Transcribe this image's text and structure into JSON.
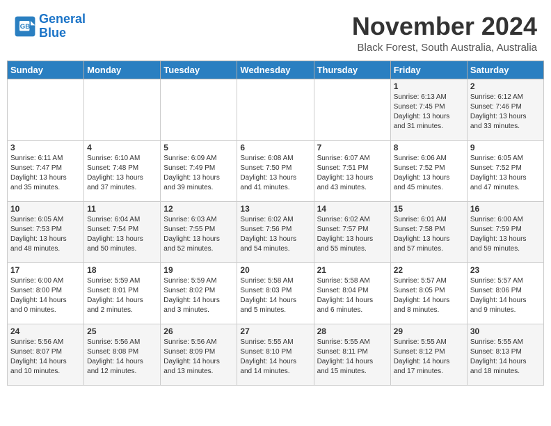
{
  "header": {
    "logo_line1": "General",
    "logo_line2": "Blue",
    "month_title": "November 2024",
    "location": "Black Forest, South Australia, Australia"
  },
  "weekdays": [
    "Sunday",
    "Monday",
    "Tuesday",
    "Wednesday",
    "Thursday",
    "Friday",
    "Saturday"
  ],
  "weeks": [
    [
      {
        "day": "",
        "info": ""
      },
      {
        "day": "",
        "info": ""
      },
      {
        "day": "",
        "info": ""
      },
      {
        "day": "",
        "info": ""
      },
      {
        "day": "",
        "info": ""
      },
      {
        "day": "1",
        "info": "Sunrise: 6:13 AM\nSunset: 7:45 PM\nDaylight: 13 hours\nand 31 minutes."
      },
      {
        "day": "2",
        "info": "Sunrise: 6:12 AM\nSunset: 7:46 PM\nDaylight: 13 hours\nand 33 minutes."
      }
    ],
    [
      {
        "day": "3",
        "info": "Sunrise: 6:11 AM\nSunset: 7:47 PM\nDaylight: 13 hours\nand 35 minutes."
      },
      {
        "day": "4",
        "info": "Sunrise: 6:10 AM\nSunset: 7:48 PM\nDaylight: 13 hours\nand 37 minutes."
      },
      {
        "day": "5",
        "info": "Sunrise: 6:09 AM\nSunset: 7:49 PM\nDaylight: 13 hours\nand 39 minutes."
      },
      {
        "day": "6",
        "info": "Sunrise: 6:08 AM\nSunset: 7:50 PM\nDaylight: 13 hours\nand 41 minutes."
      },
      {
        "day": "7",
        "info": "Sunrise: 6:07 AM\nSunset: 7:51 PM\nDaylight: 13 hours\nand 43 minutes."
      },
      {
        "day": "8",
        "info": "Sunrise: 6:06 AM\nSunset: 7:52 PM\nDaylight: 13 hours\nand 45 minutes."
      },
      {
        "day": "9",
        "info": "Sunrise: 6:05 AM\nSunset: 7:52 PM\nDaylight: 13 hours\nand 47 minutes."
      }
    ],
    [
      {
        "day": "10",
        "info": "Sunrise: 6:05 AM\nSunset: 7:53 PM\nDaylight: 13 hours\nand 48 minutes."
      },
      {
        "day": "11",
        "info": "Sunrise: 6:04 AM\nSunset: 7:54 PM\nDaylight: 13 hours\nand 50 minutes."
      },
      {
        "day": "12",
        "info": "Sunrise: 6:03 AM\nSunset: 7:55 PM\nDaylight: 13 hours\nand 52 minutes."
      },
      {
        "day": "13",
        "info": "Sunrise: 6:02 AM\nSunset: 7:56 PM\nDaylight: 13 hours\nand 54 minutes."
      },
      {
        "day": "14",
        "info": "Sunrise: 6:02 AM\nSunset: 7:57 PM\nDaylight: 13 hours\nand 55 minutes."
      },
      {
        "day": "15",
        "info": "Sunrise: 6:01 AM\nSunset: 7:58 PM\nDaylight: 13 hours\nand 57 minutes."
      },
      {
        "day": "16",
        "info": "Sunrise: 6:00 AM\nSunset: 7:59 PM\nDaylight: 13 hours\nand 59 minutes."
      }
    ],
    [
      {
        "day": "17",
        "info": "Sunrise: 6:00 AM\nSunset: 8:00 PM\nDaylight: 14 hours\nand 0 minutes."
      },
      {
        "day": "18",
        "info": "Sunrise: 5:59 AM\nSunset: 8:01 PM\nDaylight: 14 hours\nand 2 minutes."
      },
      {
        "day": "19",
        "info": "Sunrise: 5:59 AM\nSunset: 8:02 PM\nDaylight: 14 hours\nand 3 minutes."
      },
      {
        "day": "20",
        "info": "Sunrise: 5:58 AM\nSunset: 8:03 PM\nDaylight: 14 hours\nand 5 minutes."
      },
      {
        "day": "21",
        "info": "Sunrise: 5:58 AM\nSunset: 8:04 PM\nDaylight: 14 hours\nand 6 minutes."
      },
      {
        "day": "22",
        "info": "Sunrise: 5:57 AM\nSunset: 8:05 PM\nDaylight: 14 hours\nand 8 minutes."
      },
      {
        "day": "23",
        "info": "Sunrise: 5:57 AM\nSunset: 8:06 PM\nDaylight: 14 hours\nand 9 minutes."
      }
    ],
    [
      {
        "day": "24",
        "info": "Sunrise: 5:56 AM\nSunset: 8:07 PM\nDaylight: 14 hours\nand 10 minutes."
      },
      {
        "day": "25",
        "info": "Sunrise: 5:56 AM\nSunset: 8:08 PM\nDaylight: 14 hours\nand 12 minutes."
      },
      {
        "day": "26",
        "info": "Sunrise: 5:56 AM\nSunset: 8:09 PM\nDaylight: 14 hours\nand 13 minutes."
      },
      {
        "day": "27",
        "info": "Sunrise: 5:55 AM\nSunset: 8:10 PM\nDaylight: 14 hours\nand 14 minutes."
      },
      {
        "day": "28",
        "info": "Sunrise: 5:55 AM\nSunset: 8:11 PM\nDaylight: 14 hours\nand 15 minutes."
      },
      {
        "day": "29",
        "info": "Sunrise: 5:55 AM\nSunset: 8:12 PM\nDaylight: 14 hours\nand 17 minutes."
      },
      {
        "day": "30",
        "info": "Sunrise: 5:55 AM\nSunset: 8:13 PM\nDaylight: 14 hours\nand 18 minutes."
      }
    ]
  ]
}
